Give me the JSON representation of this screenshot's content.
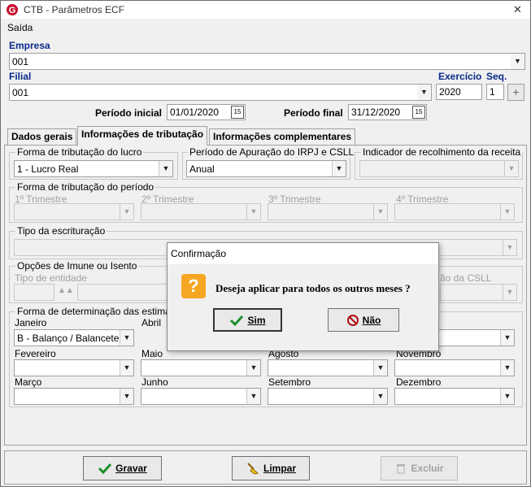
{
  "window": {
    "title": "CTB - Parâmetros ECF",
    "close": "✕"
  },
  "menu": {
    "saida": "Saída"
  },
  "empresa": {
    "label": "Empresa",
    "value": "001"
  },
  "filial": {
    "label": "Filial",
    "value": "001"
  },
  "exercicio": {
    "label": "Exercício",
    "value": "2020"
  },
  "seq": {
    "label": "Seq.",
    "value": "1",
    "add": "+"
  },
  "periodo_inicial": {
    "label": "Período inicial",
    "value": "01/01/2020",
    "cal": "15"
  },
  "periodo_final": {
    "label": "Período final",
    "value": "31/12/2020",
    "cal": "15"
  },
  "tabs": [
    "Dados gerais",
    "Informações de tributação",
    "Informações complementares"
  ],
  "forma_tributacao": {
    "label": "Forma de tributação do lucro",
    "value": "1 - Lucro Real"
  },
  "periodo_apuracao": {
    "label": "Período de Apuração do IRPJ e CSLL",
    "value": "Anual"
  },
  "indicador_recolhimento": {
    "label": "Indicador de recolhimento da receita",
    "value": ""
  },
  "forma_periodo": {
    "label": "Forma de tributação do período",
    "trimestres": [
      "1º Trimestre",
      "2º Trimestre",
      "3º Trimestre",
      "4º Trimestre"
    ]
  },
  "tipo_escrituracao": {
    "label": "Tipo da escrituração"
  },
  "imune": {
    "label": "Opções de Imune ou Isento",
    "tipo_entidade": "Tipo de entidade",
    "csll_partial": "ão da CSLL"
  },
  "estimativas": {
    "label": "Forma de determinação das estimativas",
    "meses": [
      "Janeiro",
      "Abril",
      "Fevereiro",
      "Maio",
      "Agosto",
      "Novembro",
      "Março",
      "Junho",
      "Setembro",
      "Dezembro"
    ],
    "janeiro_value": "B - Balanço / Balancete de"
  },
  "dialog": {
    "title": "Confirmação",
    "message": "Deseja aplicar para todos os outros meses ?",
    "sim": "Sim",
    "nao": "Não"
  },
  "footer": {
    "gravar": "Gravar",
    "limpar": "Limpar",
    "excluir": "Excluir"
  },
  "colors": {
    "accent_blue": "#0a2a8c",
    "logo_red": "#c8102e",
    "dialog_icon": "#f5a623"
  }
}
